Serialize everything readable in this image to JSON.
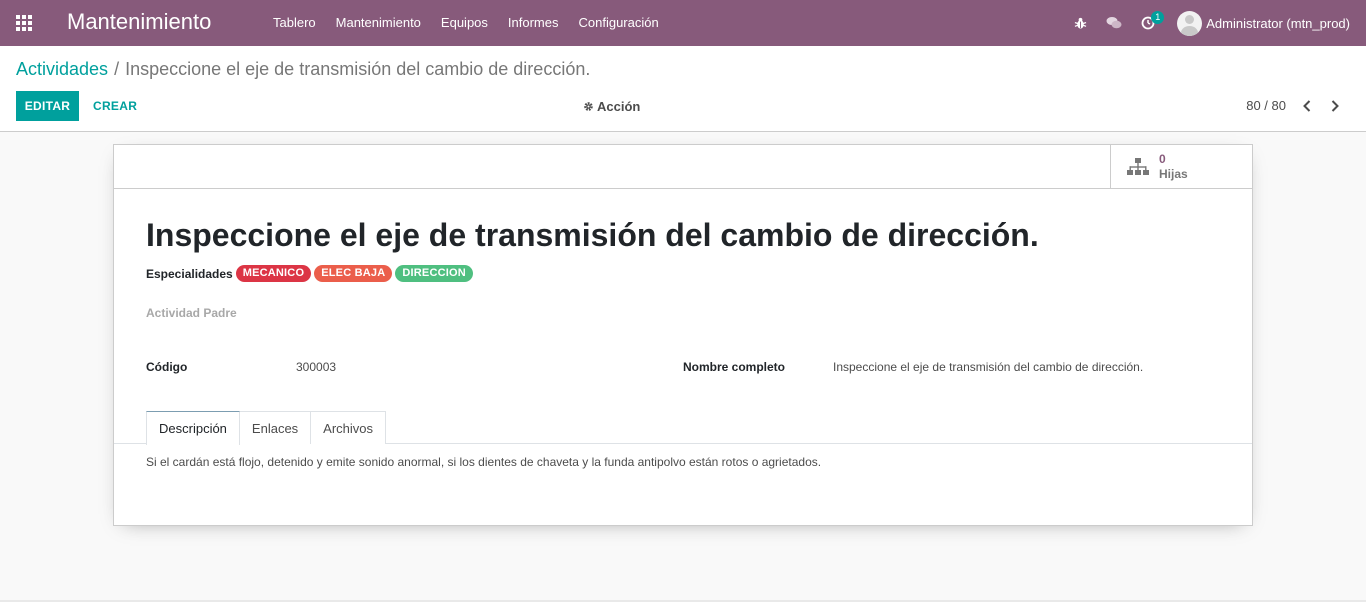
{
  "navbar": {
    "brand": "Mantenimiento",
    "menu": [
      "Tablero",
      "Mantenimiento",
      "Equipos",
      "Informes",
      "Configuración"
    ],
    "activity_count": "1",
    "user": "Administrator (mtn_prod)"
  },
  "breadcrumb": {
    "parent": "Actividades",
    "current": "Inspeccione el eje de transmisión del cambio de dirección."
  },
  "toolbar": {
    "edit_label": "EDITAR",
    "create_label": "CREAR",
    "action_label": "Acción",
    "pager": "80 / 80"
  },
  "stat_button": {
    "value": "0",
    "label": "Hijas"
  },
  "form": {
    "title": "Inspeccione el eje de transmisión del cambio de dirección.",
    "specialties_label": "Especialidades",
    "tags": [
      {
        "label": "MECANICO",
        "color": "#dc3545"
      },
      {
        "label": "ELEC BAJA",
        "color": "#eb5e4b"
      },
      {
        "label": "DIRECCION",
        "color": "#4fbf80"
      }
    ],
    "parent_label": "Actividad Padre",
    "code_label": "Código",
    "code_value": "300003",
    "fullname_label": "Nombre completo",
    "fullname_value": "Inspeccione el eje de transmisión del cambio de dirección.",
    "tabs": [
      "Descripción",
      "Enlaces",
      "Archivos"
    ],
    "description": "Si el cardán está flojo, detenido y emite sonido anormal, si los dientes de chaveta y la funda antipolvo están rotos o agrietados."
  },
  "colors": {
    "navbar": "#875a7b",
    "primary": "#00a09d"
  }
}
